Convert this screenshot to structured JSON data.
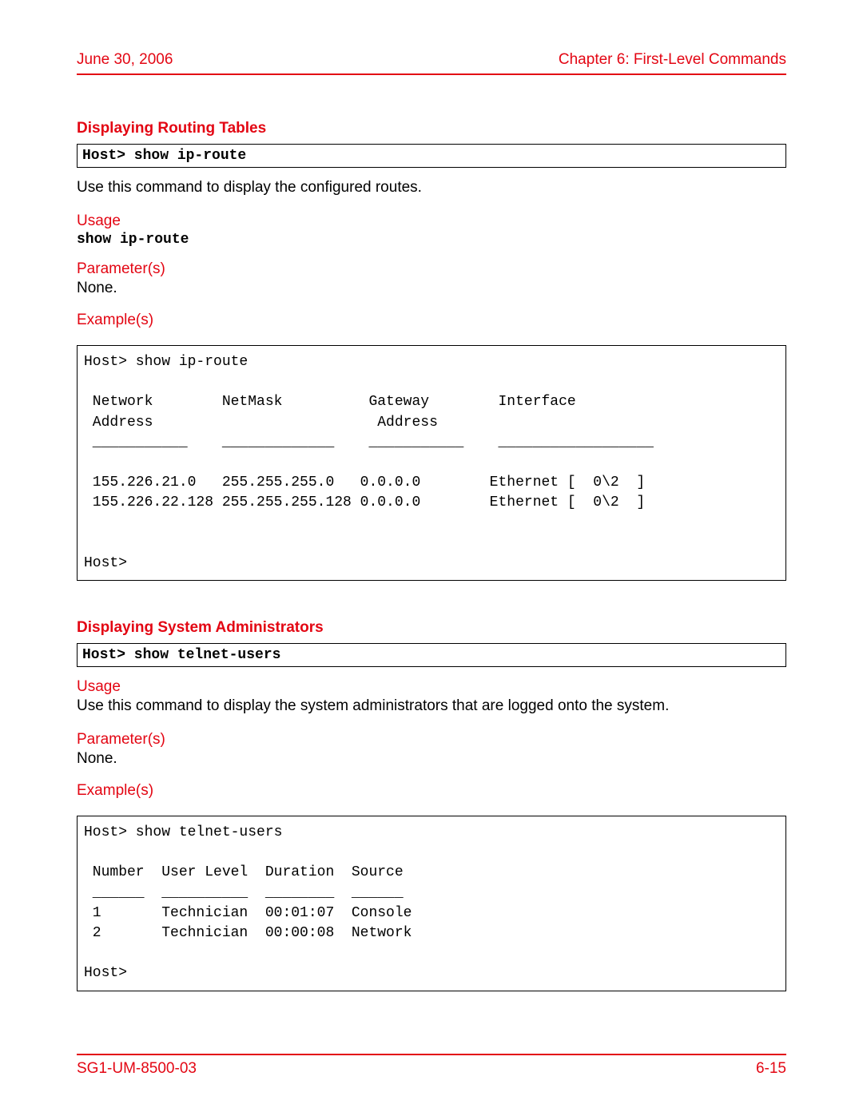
{
  "header": {
    "date": "June 30, 2006",
    "chapter": "Chapter 6: First-Level Commands"
  },
  "section1": {
    "title": "Displaying Routing Tables",
    "command": "Host> show ip-route",
    "description": "Use this command to display the configured routes.",
    "usage_label": "Usage",
    "usage_cmd": "show ip-route",
    "parameters_label": "Parameter(s)",
    "parameters_value": "None.",
    "examples_label": "Example(s)",
    "example_text": "Host> show ip-route\n\n Network        NetMask          Gateway        Interface\n Address                          Address\n ___________    _____________    ___________    __________________\n\n 155.226.21.0   255.255.255.0   0.0.0.0        Ethernet [  0\\2  ]\n 155.226.22.128 255.255.255.128 0.0.0.0        Ethernet [  0\\2  ]\n\n\nHost>"
  },
  "section2": {
    "title": "Displaying System Administrators",
    "command": "Host> show telnet-users",
    "usage_label": "Usage",
    "usage_desc": "Use this command to display the system administrators that are logged onto the system.",
    "parameters_label": "Parameter(s)",
    "parameters_value": "None.",
    "examples_label": "Example(s)",
    "example_text": "Host> show telnet-users\n\n Number  User Level  Duration  Source\n ______  __________  ________  ______\n 1       Technician  00:01:07  Console\n 2       Technician  00:00:08  Network\n\nHost>"
  },
  "footer": {
    "doc_id": "SG1-UM-8500-03",
    "page_num": "6-15"
  }
}
